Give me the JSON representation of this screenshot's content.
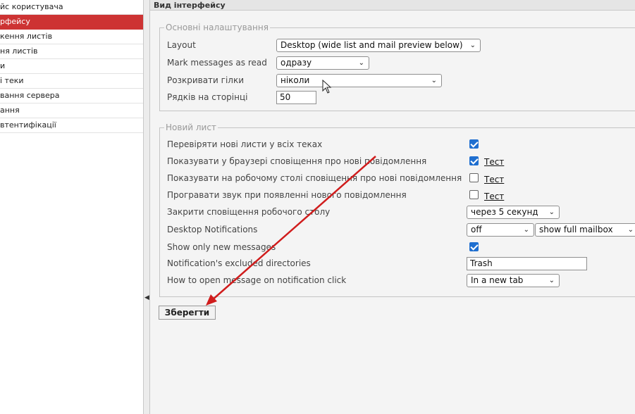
{
  "sidebar": {
    "items": [
      {
        "label": "йс користувача",
        "selected": false
      },
      {
        "label": "рфейсу",
        "selected": true
      },
      {
        "label": "кення листів",
        "selected": false
      },
      {
        "label": "ня листів",
        "selected": false
      },
      {
        "label": "и",
        "selected": false
      },
      {
        "label": "і теки",
        "selected": false
      },
      {
        "label": "вання сервера",
        "selected": false
      },
      {
        "label": "ання",
        "selected": false
      },
      {
        "label": "втентифікації",
        "selected": false
      }
    ]
  },
  "header": {
    "title": "Вид інтерфейсу"
  },
  "main_settings": {
    "legend": "Основні налаштування",
    "layout": {
      "label": "Layout",
      "value": "Desktop (wide list and mail preview below)"
    },
    "mark_read": {
      "label": "Mark messages as read",
      "value": "одразу"
    },
    "expand_threads": {
      "label": "Розкривати гілки",
      "value": "ніколи"
    },
    "rows_per_page": {
      "label": "Рядків на сторінці",
      "value": "50"
    }
  },
  "new_mail": {
    "legend": "Новий лист",
    "check_all": {
      "label": "Перевіряти нові листи у всіх теках",
      "checked": true
    },
    "browser_notify": {
      "label": "Показувати у браузері сповіщення про нові повідомлення",
      "checked": true,
      "test": "Тест"
    },
    "desktop_notify": {
      "label": "Показувати на робочому столі сповіщення про нові повідомлення",
      "checked": false,
      "test": "Тест"
    },
    "sound": {
      "label": "Програвати звук при появленні нового повідомлення",
      "checked": false,
      "test": "Тест"
    },
    "close_notify": {
      "label": "Закрити сповіщення робочого столу",
      "value": "через 5 секунд"
    },
    "desktop_notifications": {
      "label": "Desktop Notifications",
      "value": "off",
      "value2": "show full mailbox"
    },
    "show_only_new": {
      "label": "Show only new messages",
      "checked": true
    },
    "excluded_dirs": {
      "label": "Notification's excluded directories",
      "value": "Trash"
    },
    "open_on_click": {
      "label": "How to open message on notification click",
      "value": "In a new tab"
    }
  },
  "save_label": "Зберегти",
  "colors": {
    "selected": "#cd3333",
    "checkbox": "#1f6fd0",
    "arrow": "#d01c1c"
  }
}
